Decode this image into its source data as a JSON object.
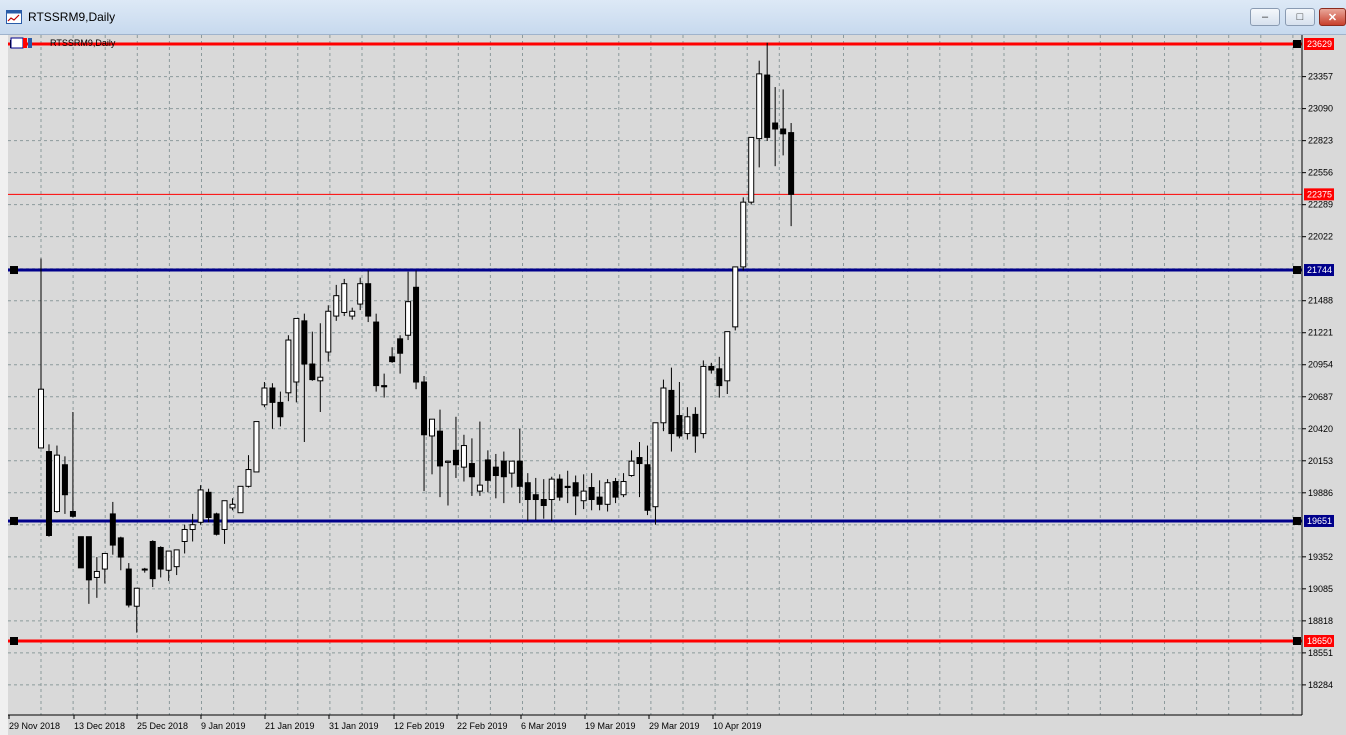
{
  "window": {
    "title": "RTSSRM9,Daily",
    "buttons": {
      "minimize": "‒",
      "maximize": "□",
      "close": "✕"
    }
  },
  "chart": {
    "caption": "RTSSRM9,Daily",
    "price_labels": [
      "23357",
      "23090",
      "22823",
      "22556",
      "22289",
      "22022",
      "21488",
      "21221",
      "20954",
      "20687",
      "20420",
      "20153",
      "19886",
      "19352",
      "19085",
      "18818",
      "18551",
      "18284"
    ],
    "date_labels": [
      "29 Nov 2018",
      "13 Dec 2018",
      "25 Dec 2018",
      "9 Jan 2019",
      "21 Jan 2019",
      "31 Jan 2019",
      "12 Feb 2019",
      "22 Feb 2019",
      "6 Mar 2019",
      "19 Mar 2019",
      "29 Mar 2019",
      "10 Apr 2019"
    ],
    "colors": {
      "background": "#d9d9d9",
      "grid": "#8c9a9c",
      "bull_body": "#ffffff",
      "bear_body": "#000000",
      "red_level": "#ff0000",
      "blue_level": "#00008b"
    },
    "levels": [
      {
        "value": "23629",
        "color": "red",
        "style": "thick"
      },
      {
        "value": "22375",
        "color": "red",
        "style": "thin"
      },
      {
        "value": "21744",
        "color": "blue",
        "style": "thick"
      },
      {
        "value": "19651",
        "color": "blue",
        "style": "thick"
      },
      {
        "value": "18650",
        "color": "red",
        "style": "thick"
      }
    ]
  },
  "chart_data": {
    "type": "candlestick",
    "title": "RTSSRM9,Daily",
    "ylim": [
      18200,
      23700
    ],
    "candles": [
      {
        "o": 20260,
        "h": 21840,
        "c": 20750,
        "l": 20260
      },
      {
        "o": 20230,
        "h": 20290,
        "c": 19530,
        "l": 19520
      },
      {
        "o": 19730,
        "h": 20280,
        "c": 20200,
        "l": 19720
      },
      {
        "o": 20120,
        "h": 20190,
        "c": 19870,
        "l": 19710
      },
      {
        "o": 19730,
        "h": 20560,
        "c": 19690,
        "l": 19680
      },
      {
        "o": 19520,
        "h": 19520,
        "c": 19260,
        "l": 19260
      },
      {
        "o": 19520,
        "h": 19520,
        "c": 19160,
        "l": 18960
      },
      {
        "o": 19180,
        "h": 19350,
        "c": 19230,
        "l": 19010
      },
      {
        "o": 19250,
        "h": 19370,
        "c": 19380,
        "l": 19130
      },
      {
        "o": 19710,
        "h": 19810,
        "c": 19450,
        "l": 19370
      },
      {
        "o": 19510,
        "h": 19520,
        "c": 19350,
        "l": 19240
      },
      {
        "o": 19250,
        "h": 19300,
        "c": 18950,
        "l": 18930
      },
      {
        "o": 18940,
        "h": 19000,
        "c": 19090,
        "l": 18720
      },
      {
        "o": 19250,
        "h": 19260,
        "c": 19250,
        "l": 19220
      },
      {
        "o": 19480,
        "h": 19490,
        "c": 19170,
        "l": 19100
      },
      {
        "o": 19430,
        "h": 19440,
        "c": 19250,
        "l": 19180
      },
      {
        "o": 19240,
        "h": 19280,
        "c": 19400,
        "l": 19150
      },
      {
        "o": 19270,
        "h": 19320,
        "c": 19410,
        "l": 19200
      },
      {
        "o": 19480,
        "h": 19620,
        "c": 19580,
        "l": 19380
      },
      {
        "o": 19580,
        "h": 19710,
        "c": 19620,
        "l": 19480
      },
      {
        "o": 19640,
        "h": 19950,
        "c": 19910,
        "l": 19620
      },
      {
        "o": 19890,
        "h": 19920,
        "c": 19680,
        "l": 19640
      },
      {
        "o": 19710,
        "h": 19720,
        "c": 19540,
        "l": 19530
      },
      {
        "o": 19580,
        "h": 19820,
        "c": 19820,
        "l": 19460
      },
      {
        "o": 19760,
        "h": 19840,
        "c": 19790,
        "l": 19740
      },
      {
        "o": 19720,
        "h": 19940,
        "c": 19940,
        "l": 19720
      },
      {
        "o": 19940,
        "h": 20200,
        "c": 20080,
        "l": 19930
      },
      {
        "o": 20060,
        "h": 20450,
        "c": 20480,
        "l": 20060
      },
      {
        "o": 20620,
        "h": 20810,
        "c": 20760,
        "l": 20600
      },
      {
        "o": 20760,
        "h": 20800,
        "c": 20640,
        "l": 20420
      },
      {
        "o": 20640,
        "h": 20730,
        "c": 20520,
        "l": 20440
      },
      {
        "o": 20720,
        "h": 21200,
        "c": 21160,
        "l": 20650
      },
      {
        "o": 20810,
        "h": 21320,
        "c": 21340,
        "l": 20640
      },
      {
        "o": 21320,
        "h": 21380,
        "c": 20960,
        "l": 20310
      },
      {
        "o": 20960,
        "h": 21230,
        "c": 20830,
        "l": 20820
      },
      {
        "o": 20820,
        "h": 21300,
        "c": 20850,
        "l": 20560
      },
      {
        "o": 21060,
        "h": 21450,
        "c": 21400,
        "l": 20980
      },
      {
        "o": 21360,
        "h": 21620,
        "c": 21530,
        "l": 21320
      },
      {
        "o": 21390,
        "h": 21670,
        "c": 21630,
        "l": 21360
      },
      {
        "o": 21360,
        "h": 21430,
        "c": 21400,
        "l": 21330
      },
      {
        "o": 21460,
        "h": 21680,
        "c": 21630,
        "l": 21410
      },
      {
        "o": 21630,
        "h": 21740,
        "c": 21360,
        "l": 21310
      },
      {
        "o": 21310,
        "h": 21380,
        "c": 20780,
        "l": 20730
      },
      {
        "o": 20780,
        "h": 20880,
        "c": 20770,
        "l": 20680
      },
      {
        "o": 21020,
        "h": 21100,
        "c": 20980,
        "l": 20970
      },
      {
        "o": 21170,
        "h": 21200,
        "c": 21050,
        "l": 20880
      },
      {
        "o": 21200,
        "h": 21730,
        "c": 21480,
        "l": 21160
      },
      {
        "o": 21600,
        "h": 21740,
        "c": 20810,
        "l": 20750
      },
      {
        "o": 20810,
        "h": 20860,
        "c": 20370,
        "l": 19900
      },
      {
        "o": 20360,
        "h": 20400,
        "c": 20500,
        "l": 20040
      },
      {
        "o": 20400,
        "h": 20580,
        "c": 20110,
        "l": 19850
      },
      {
        "o": 20140,
        "h": 20140,
        "c": 20150,
        "l": 19780
      },
      {
        "o": 20240,
        "h": 20520,
        "c": 20120,
        "l": 20010
      },
      {
        "o": 20100,
        "h": 20370,
        "c": 20280,
        "l": 19980
      },
      {
        "o": 20130,
        "h": 20340,
        "c": 20020,
        "l": 19860
      },
      {
        "o": 19900,
        "h": 20480,
        "c": 19950,
        "l": 19860
      },
      {
        "o": 20160,
        "h": 20240,
        "c": 19990,
        "l": 19890
      },
      {
        "o": 20100,
        "h": 20210,
        "c": 20030,
        "l": 19840
      },
      {
        "o": 20150,
        "h": 20230,
        "c": 20020,
        "l": 19800
      },
      {
        "o": 20050,
        "h": 20130,
        "c": 20150,
        "l": 19930
      },
      {
        "o": 20150,
        "h": 20420,
        "c": 19940,
        "l": 19800
      },
      {
        "o": 19970,
        "h": 20050,
        "c": 19830,
        "l": 19650
      },
      {
        "o": 19870,
        "h": 20010,
        "c": 19830,
        "l": 19660
      },
      {
        "o": 19830,
        "h": 20000,
        "c": 19780,
        "l": 19670
      },
      {
        "o": 19830,
        "h": 20020,
        "c": 20000,
        "l": 19650
      },
      {
        "o": 20000,
        "h": 20040,
        "c": 19850,
        "l": 19820
      },
      {
        "o": 19940,
        "h": 20070,
        "c": 19930,
        "l": 19800
      },
      {
        "o": 19970,
        "h": 20030,
        "c": 19860,
        "l": 19700
      },
      {
        "o": 19820,
        "h": 20040,
        "c": 19900,
        "l": 19750
      },
      {
        "o": 19930,
        "h": 20050,
        "c": 19830,
        "l": 19740
      },
      {
        "o": 19850,
        "h": 19990,
        "c": 19790,
        "l": 19740
      },
      {
        "o": 19790,
        "h": 20000,
        "c": 19970,
        "l": 19730
      },
      {
        "o": 19980,
        "h": 20010,
        "c": 19850,
        "l": 19800
      },
      {
        "o": 19870,
        "h": 20050,
        "c": 19980,
        "l": 19850
      },
      {
        "o": 20030,
        "h": 20240,
        "c": 20150,
        "l": 20020
      },
      {
        "o": 20180,
        "h": 20310,
        "c": 20130,
        "l": 19850
      },
      {
        "o": 20120,
        "h": 20280,
        "c": 19740,
        "l": 19700
      },
      {
        "o": 19770,
        "h": 20470,
        "c": 20470,
        "l": 19620
      },
      {
        "o": 20470,
        "h": 20830,
        "c": 20760,
        "l": 20400
      },
      {
        "o": 20740,
        "h": 20930,
        "c": 20380,
        "l": 20230
      },
      {
        "o": 20530,
        "h": 20810,
        "c": 20360,
        "l": 20340
      },
      {
        "o": 20380,
        "h": 20600,
        "c": 20520,
        "l": 20330
      },
      {
        "o": 20540,
        "h": 20600,
        "c": 20360,
        "l": 20220
      },
      {
        "o": 20380,
        "h": 20990,
        "c": 20940,
        "l": 20340
      },
      {
        "o": 20940,
        "h": 20970,
        "c": 20910,
        "l": 20880
      },
      {
        "o": 20920,
        "h": 21020,
        "c": 20780,
        "l": 20680
      },
      {
        "o": 20820,
        "h": 21230,
        "c": 21230,
        "l": 20710
      },
      {
        "o": 21270,
        "h": 21760,
        "c": 21770,
        "l": 21240
      },
      {
        "o": 21770,
        "h": 22350,
        "c": 22310,
        "l": 21740
      },
      {
        "o": 22310,
        "h": 22820,
        "c": 22850,
        "l": 22290
      },
      {
        "o": 22840,
        "h": 23490,
        "c": 23380,
        "l": 22600
      },
      {
        "o": 23370,
        "h": 23640,
        "c": 22850,
        "l": 22820
      },
      {
        "o": 22970,
        "h": 23270,
        "c": 22920,
        "l": 22610
      },
      {
        "o": 22920,
        "h": 23250,
        "c": 22880,
        "l": 22700
      },
      {
        "o": 22890,
        "h": 22970,
        "c": 22375,
        "l": 22110
      }
    ]
  }
}
